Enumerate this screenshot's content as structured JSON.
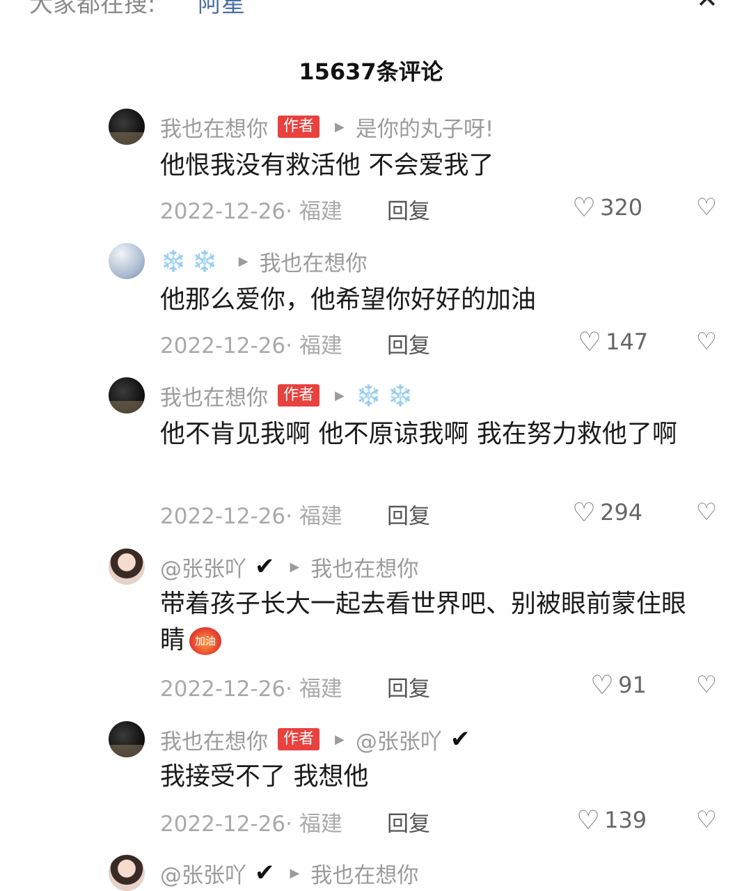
{
  "search_bar": {
    "label": "大家都在搜:",
    "term": "阿星",
    "term_icon": "search-icon",
    "close_icon": "close-icon"
  },
  "comment_count": "15637条评论",
  "comments": [
    {
      "author": "我也在想你",
      "author_badge": "作者",
      "reply_to": "是你的丸子呀!",
      "text": "他恨我没有救活他 不会爱我了",
      "date_location": "2022-12-26· 福建",
      "reply_label": "回复",
      "likes": "320"
    },
    {
      "author": "❄️❄️",
      "author_badge": "",
      "reply_to": "我也在想你",
      "text": "他那么爱你，他希望你好好的加油",
      "date_location": "2022-12-26· 福建",
      "reply_label": "回复",
      "likes": "147"
    },
    {
      "author": "我也在想你",
      "author_badge": "作者",
      "reply_to": "❄️❄️",
      "text": "他不肯见我啊 他不原谅我啊 我在努力救他了啊",
      "date_location": "2022-12-26· 福建",
      "reply_label": "回复",
      "likes": "294"
    },
    {
      "author": "@张张吖",
      "author_badge": "",
      "reply_to": "我也在想你",
      "text": "带着孩子长大一起去看世界吧、别被眼前蒙住眼睛",
      "emoji_label": "加油",
      "date_location": "2022-12-26· 福建",
      "reply_label": "回复",
      "likes": "91"
    },
    {
      "author": "我也在想你",
      "author_badge": "作者",
      "reply_to": "@张张吖",
      "text": "我接受不了 我想他",
      "date_location": "2022-12-26· 福建",
      "reply_label": "回复",
      "likes": "139"
    },
    {
      "author": "@张张吖",
      "author_badge": "",
      "reply_to": "我也在想你"
    }
  ],
  "icons": {
    "like": "heart-outline-icon",
    "dislike": "broken-heart-icon",
    "verified": "check-mark-icon",
    "reply_arrow": "triangle-right-icon"
  }
}
